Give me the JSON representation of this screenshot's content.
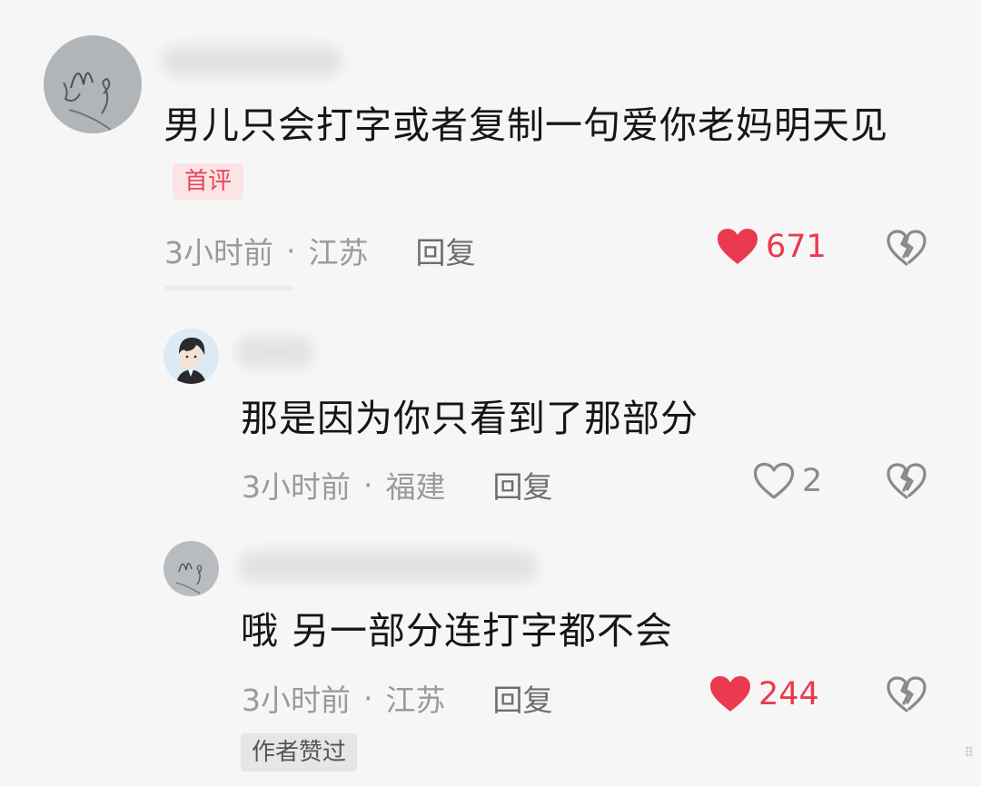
{
  "colors": {
    "background": "#f6f6f6",
    "like_red": "#ea3a4f",
    "badge_bg": "#fbe3e6",
    "badge_text": "#e8475a",
    "meta_gray": "#9a9a9a"
  },
  "comments": [
    {
      "text": "男儿只会打字或者复制一句爱你老妈明天见",
      "badge": "首评",
      "time": "3小时前",
      "separator": "·",
      "location": "江苏",
      "reply_label": "回复",
      "like_count": "671",
      "liked": true,
      "like_icon": "heart-filled-icon",
      "dislike_icon": "broken-heart-icon"
    },
    {
      "text": "那是因为你只看到了那部分",
      "time": "3小时前",
      "separator": "·",
      "location": "福建",
      "reply_label": "回复",
      "like_count": "2",
      "liked": false,
      "like_icon": "heart-outline-icon",
      "dislike_icon": "broken-heart-icon"
    },
    {
      "text": "哦 另一部分连打字都不会",
      "time": "3小时前",
      "separator": "·",
      "location": "江苏",
      "reply_label": "回复",
      "like_count": "244",
      "liked": true,
      "like_icon": "heart-filled-icon",
      "dislike_icon": "broken-heart-icon",
      "author_tag": "作者赞过"
    }
  ]
}
